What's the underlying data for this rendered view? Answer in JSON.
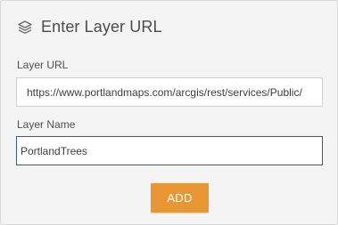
{
  "dialog": {
    "title": "Enter Layer URL",
    "header_icon": "layers-icon"
  },
  "form": {
    "layer_url": {
      "label": "Layer URL",
      "value": "https://www.portlandmaps.com/arcgis/rest/services/Public/"
    },
    "layer_name": {
      "label": "Layer Name",
      "value": "PortlandTrees"
    },
    "add_button_label": "ADD"
  },
  "colors": {
    "panel_background": "#f4f4f4",
    "title_text": "#4b4b4b",
    "focused_border": "#2f5f8e",
    "add_button": "#e89734"
  }
}
